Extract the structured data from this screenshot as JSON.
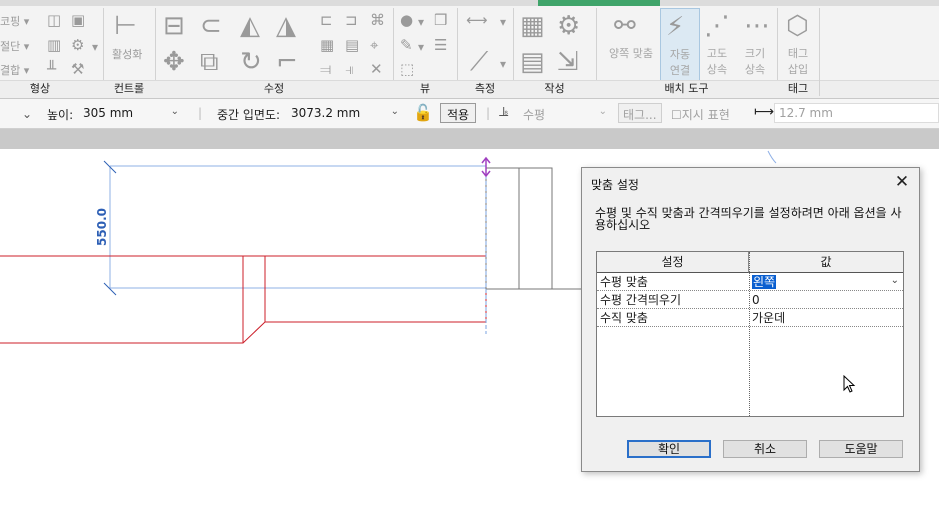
{
  "ribbon": {
    "left_labels": [
      "코핑",
      "절단",
      "결합"
    ],
    "activate_label": "활성화",
    "panels": [
      "형상",
      "컨트롤",
      "수정",
      "뷰",
      "측정",
      "작성",
      "배치 도구",
      "태그"
    ],
    "align_both_label": "양쪽 맞춤",
    "auto_connect_label": [
      "자동",
      "연결"
    ],
    "elev_inherit_label": [
      "고도",
      "상속"
    ],
    "size_inherit_label": [
      "크기",
      "상속"
    ],
    "tag_insert_label": [
      "태그",
      "삽입"
    ]
  },
  "options_bar": {
    "height_label": "높이:",
    "height_value": "305 mm",
    "mid_elev_label": "중간 입면도:",
    "mid_elev_value": "3073.2 mm",
    "apply_label": "적용",
    "orientation_value": "수평",
    "tag_button": "태그...",
    "leader_label": "지시 표현",
    "leader_length": "12.7 mm"
  },
  "canvas": {
    "dimension_text": "550.0"
  },
  "dialog": {
    "title": "맞춤 설정",
    "description": "수평 및 수직 맞춤과 간격띄우기를 설정하려면 아래 옵션을 사용하십시오",
    "columns": [
      "설정",
      "값"
    ],
    "rows": [
      {
        "setting": "수평 맞춤",
        "value": "왼쪽"
      },
      {
        "setting": "수평 간격띄우기",
        "value": "0"
      },
      {
        "setting": "수직 맞춤",
        "value": "가운데"
      }
    ],
    "ok": "확인",
    "cancel": "취소",
    "help": "도움말"
  },
  "colors": {
    "duct_red": "#cc1f2a",
    "dim_blue": "#2d5fb5",
    "dim_line": "#8fb0e6",
    "selection": "#0a5fd0"
  }
}
